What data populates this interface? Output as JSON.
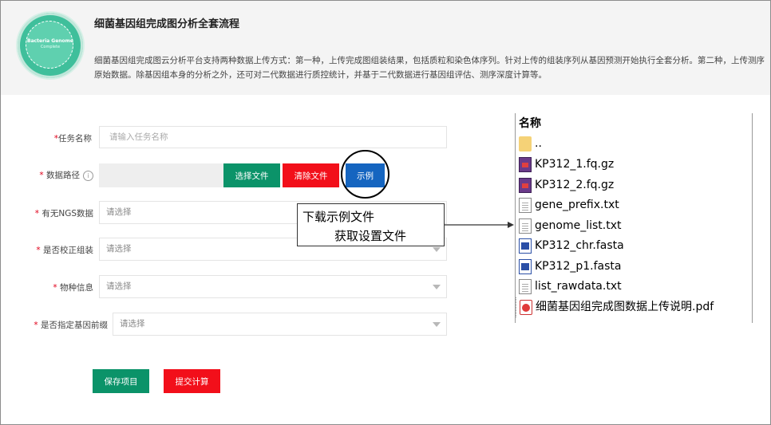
{
  "header": {
    "logo_text": "Bacteria Genome",
    "logo_subtext": "Complete",
    "title": "细菌基因组完成图分析全套流程",
    "description": "细菌基因组完成图云分析平台支持两种数据上传方式：第一种，上传完成图组装结果，包括质粒和染色体序列。针对上传的组装序列从基因预测开始执行全套分析。第二种，上传测序原始数据。除基因组本身的分析之外，还可对二代数据进行质控统计，并基于二代数据进行基因组评估、测序深度计算等。"
  },
  "form": {
    "required_mark": "*",
    "task_name": {
      "label": "任务名称",
      "placeholder": "请输入任务名称"
    },
    "data_path": {
      "label": "数据路径",
      "info_icon": "i",
      "choose_file_label": "选择文件",
      "clear_file_label": "清除文件",
      "example_label": "示例"
    },
    "ngs_data": {
      "label": "有无NGS数据",
      "value": "请选择"
    },
    "corrected_assembly": {
      "label": "是否校正组装",
      "value": "请选择"
    },
    "species_info": {
      "label": "物种信息",
      "value": "请选择"
    },
    "gene_prefix": {
      "label": "是否指定基因前缀",
      "value": "请选择"
    },
    "save_label": "保存项目",
    "submit_label": "提交计算"
  },
  "annotation": {
    "line1": "下载示例文件",
    "line2": "获取设置文件"
  },
  "explorer": {
    "column_header": "名称",
    "files": [
      {
        "name": "..",
        "icon": "folder-icon"
      },
      {
        "name": "KP312_1.fq.gz",
        "icon": "archive-icon"
      },
      {
        "name": "KP312_2.fq.gz",
        "icon": "archive-icon"
      },
      {
        "name": "gene_prefix.txt",
        "icon": "text-file-icon"
      },
      {
        "name": "genome_list.txt",
        "icon": "text-file-icon"
      },
      {
        "name": "KP312_chr.fasta",
        "icon": "fasta-file-icon"
      },
      {
        "name": "KP312_p1.fasta",
        "icon": "fasta-file-icon"
      },
      {
        "name": "list_rawdata.txt",
        "icon": "text-file-icon"
      },
      {
        "name": "细菌基因组完成图数据上传说明.pdf",
        "icon": "pdf-file-icon"
      }
    ]
  },
  "colors": {
    "green_button": "#0b9369",
    "red_button": "#f20f1a",
    "blue_button": "#1565c0",
    "required_star": "#e0001a",
    "logo_green": "#3fbf9b"
  }
}
